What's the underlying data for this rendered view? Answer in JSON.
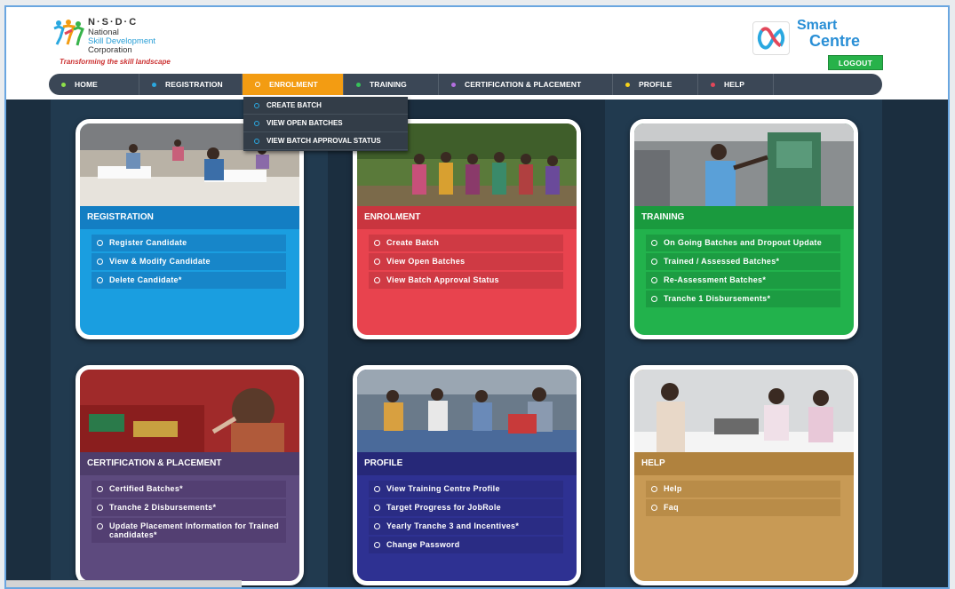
{
  "header": {
    "logo": {
      "acronym": "N·S·D·C",
      "line1": "National",
      "line2": "Skill Development",
      "line3": "Corporation",
      "tagline": "Transforming the skill landscape"
    },
    "brand": {
      "line1": "Smart",
      "line2": "Centre"
    },
    "logout_label": "LOGOUT"
  },
  "nav": {
    "items": [
      {
        "label": "HOME",
        "dot": "#8ee04a"
      },
      {
        "label": "REGISTRATION",
        "dot": "#2aa8e0"
      },
      {
        "label": "ENROLMENT",
        "dot": "#ffffff"
      },
      {
        "label": "TRAINING",
        "dot": "#37c25a"
      },
      {
        "label": "CERTIFICATION & PLACEMENT",
        "dot": "#b46fe0"
      },
      {
        "label": "PROFILE",
        "dot": "#f7d21a"
      },
      {
        "label": "HELP",
        "dot": "#e2475a"
      }
    ],
    "dropdown": [
      "CREATE BATCH",
      "VIEW OPEN BATCHES",
      "VIEW BATCH APPROVAL STATUS"
    ]
  },
  "cards": {
    "registration": {
      "title": "REGISTRATION",
      "color": "#1a9ee0",
      "links": [
        "Register Candidate",
        "View & Modify Candidate",
        "Delete Candidate*"
      ]
    },
    "enrolment": {
      "title": "ENROLMENT",
      "color": "#e8434e",
      "links": [
        "Create Batch",
        "View Open Batches",
        "View Batch Approval Status"
      ]
    },
    "training": {
      "title": "TRAINING",
      "color": "#22b24c",
      "links": [
        "On Going Batches and Dropout Update",
        "Trained / Assessed Batches*",
        "Re-Assessment Batches*",
        "Tranche 1 Disbursements*"
      ]
    },
    "certification": {
      "title": "CERTIFICATION & PLACEMENT",
      "color": "#5d4a7e",
      "links": [
        "Certified Batches*",
        "Tranche 2 Disbursements*",
        "Update Placement Information for Trained candidates*"
      ]
    },
    "profile": {
      "title": "PROFILE",
      "color": "#2e3192",
      "links": [
        "View Training Centre Profile",
        "Target Progress for JobRole",
        "Yearly Tranche 3 and Incentives*",
        "Change Password"
      ]
    },
    "help": {
      "title": "HELP",
      "color": "#c89a55",
      "links": [
        "Help",
        "Faq"
      ]
    }
  }
}
